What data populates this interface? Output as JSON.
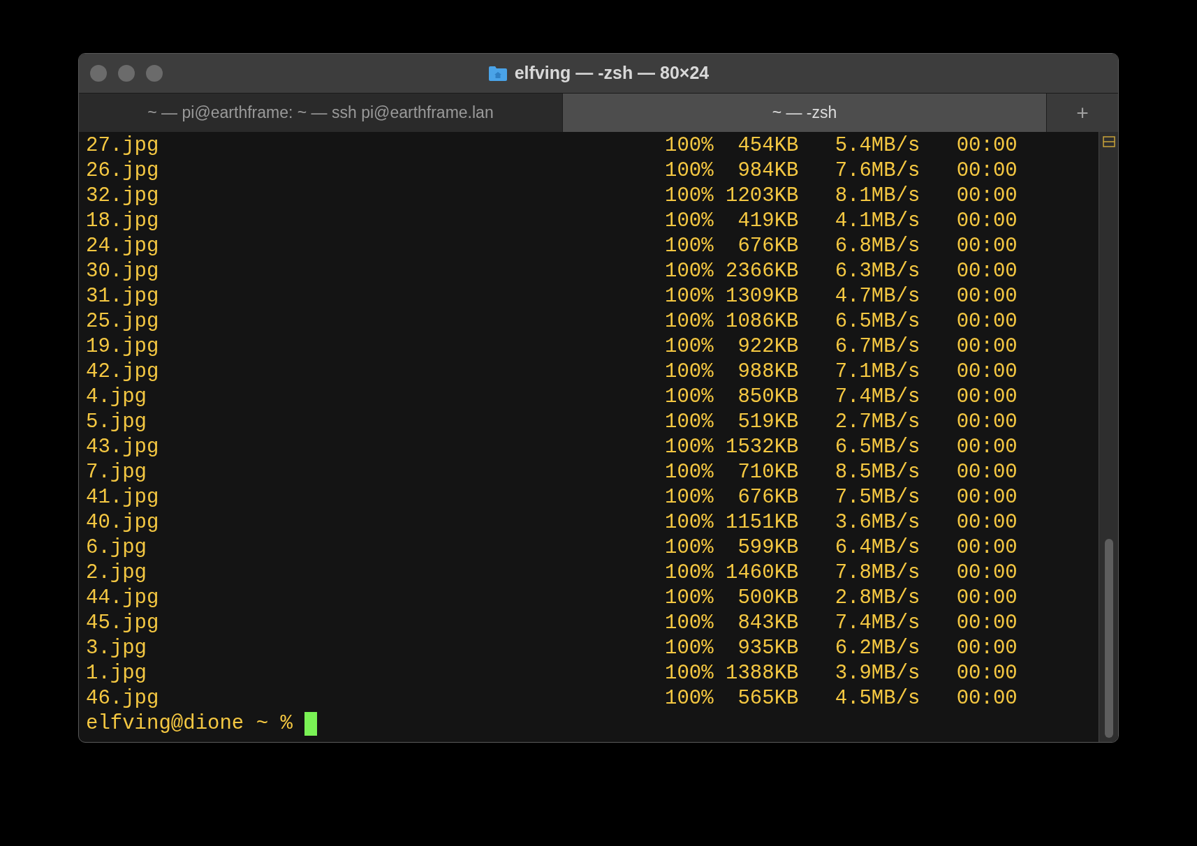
{
  "window": {
    "title": "elfving — -zsh — 80×24"
  },
  "tabs": [
    {
      "label": "~ — pi@earthframe: ~ — ssh pi@earthframe.lan",
      "selected": false
    },
    {
      "label": "~ — -zsh",
      "selected": true
    }
  ],
  "new_tab": {
    "label": "+"
  },
  "lines": [
    {
      "file": "27.jpg",
      "progress": "100%  454KB   5.4MB/s   00:00"
    },
    {
      "file": "26.jpg",
      "progress": "100%  984KB   7.6MB/s   00:00"
    },
    {
      "file": "32.jpg",
      "progress": "100% 1203KB   8.1MB/s   00:00"
    },
    {
      "file": "18.jpg",
      "progress": "100%  419KB   4.1MB/s   00:00"
    },
    {
      "file": "24.jpg",
      "progress": "100%  676KB   6.8MB/s   00:00"
    },
    {
      "file": "30.jpg",
      "progress": "100% 2366KB   6.3MB/s   00:00"
    },
    {
      "file": "31.jpg",
      "progress": "100% 1309KB   4.7MB/s   00:00"
    },
    {
      "file": "25.jpg",
      "progress": "100% 1086KB   6.5MB/s   00:00"
    },
    {
      "file": "19.jpg",
      "progress": "100%  922KB   6.7MB/s   00:00"
    },
    {
      "file": "42.jpg",
      "progress": "100%  988KB   7.1MB/s   00:00"
    },
    {
      "file": "4.jpg",
      "progress": "100%  850KB   7.4MB/s   00:00"
    },
    {
      "file": "5.jpg",
      "progress": "100%  519KB   2.7MB/s   00:00"
    },
    {
      "file": "43.jpg",
      "progress": "100% 1532KB   6.5MB/s   00:00"
    },
    {
      "file": "7.jpg",
      "progress": "100%  710KB   8.5MB/s   00:00"
    },
    {
      "file": "41.jpg",
      "progress": "100%  676KB   7.5MB/s   00:00"
    },
    {
      "file": "40.jpg",
      "progress": "100% 1151KB   3.6MB/s   00:00"
    },
    {
      "file": "6.jpg",
      "progress": "100%  599KB   6.4MB/s   00:00"
    },
    {
      "file": "2.jpg",
      "progress": "100% 1460KB   7.8MB/s   00:00"
    },
    {
      "file": "44.jpg",
      "progress": "100%  500KB   2.8MB/s   00:00"
    },
    {
      "file": "45.jpg",
      "progress": "100%  843KB   7.4MB/s   00:00"
    },
    {
      "file": "3.jpg",
      "progress": "100%  935KB   6.2MB/s   00:00"
    },
    {
      "file": "1.jpg",
      "progress": "100% 1388KB   3.9MB/s   00:00"
    },
    {
      "file": "46.jpg",
      "progress": "100%  565KB   4.5MB/s   00:00"
    }
  ],
  "prompt": "elfving@dione ~ %"
}
